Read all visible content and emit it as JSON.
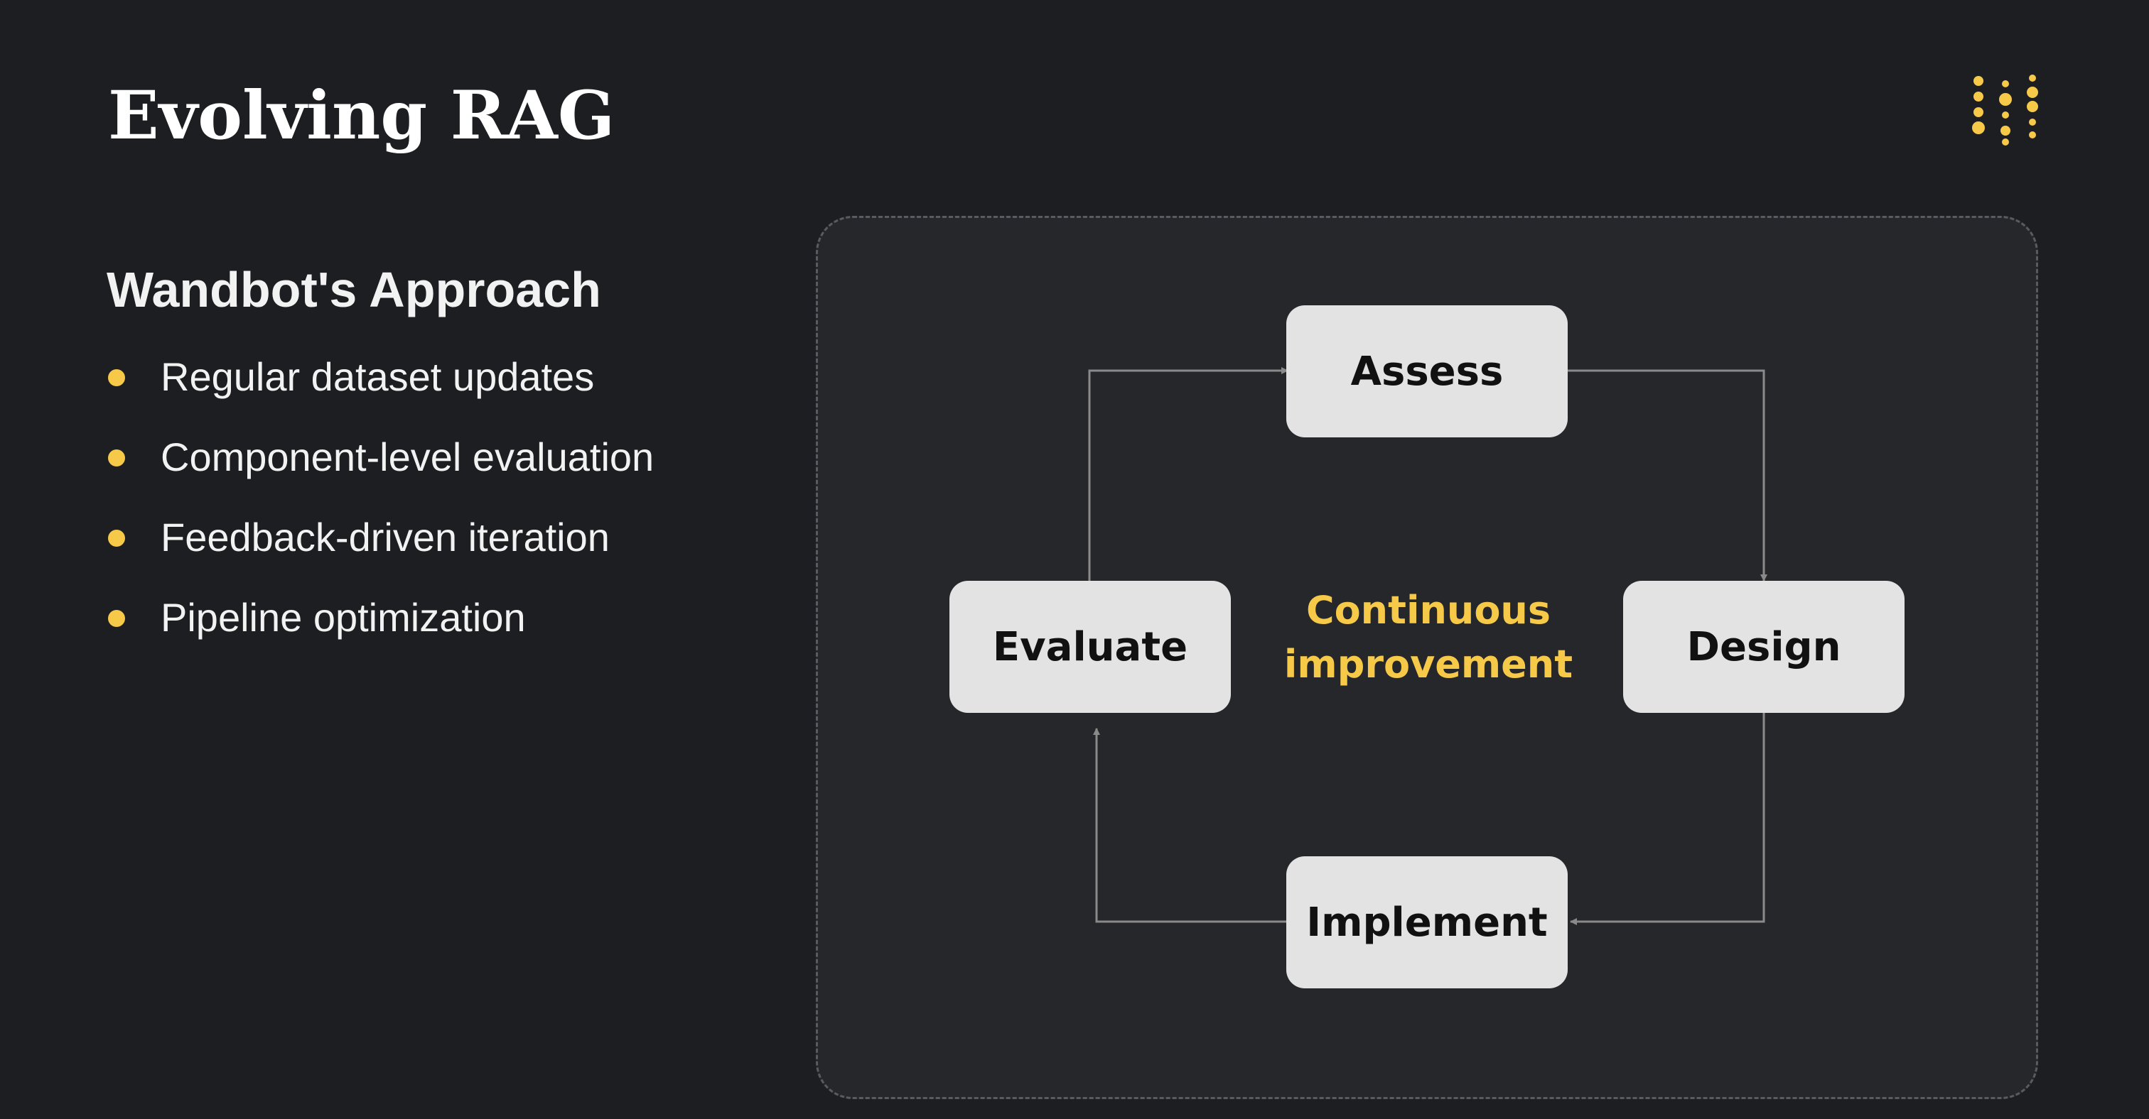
{
  "slide": {
    "title": "Evolving RAG",
    "subtitle": "Wandbot's Approach",
    "bullets": [
      "Regular dataset updates",
      "Component-level evaluation",
      "Feedback-driven iteration",
      "Pipeline optimization"
    ]
  },
  "diagram": {
    "center_line1": "Continuous",
    "center_line2": "improvement",
    "nodes": {
      "assess": "Assess",
      "design": "Design",
      "implement": "Implement",
      "evaluate": "Evaluate"
    }
  },
  "colors": {
    "background": "#1d1e22",
    "accent": "#f7c948",
    "node_fill": "#e3e3e3",
    "panel": "#26272b"
  },
  "icons": {
    "brand": "dot-grid-logo-icon",
    "bullet": "yellow-dot-icon"
  }
}
